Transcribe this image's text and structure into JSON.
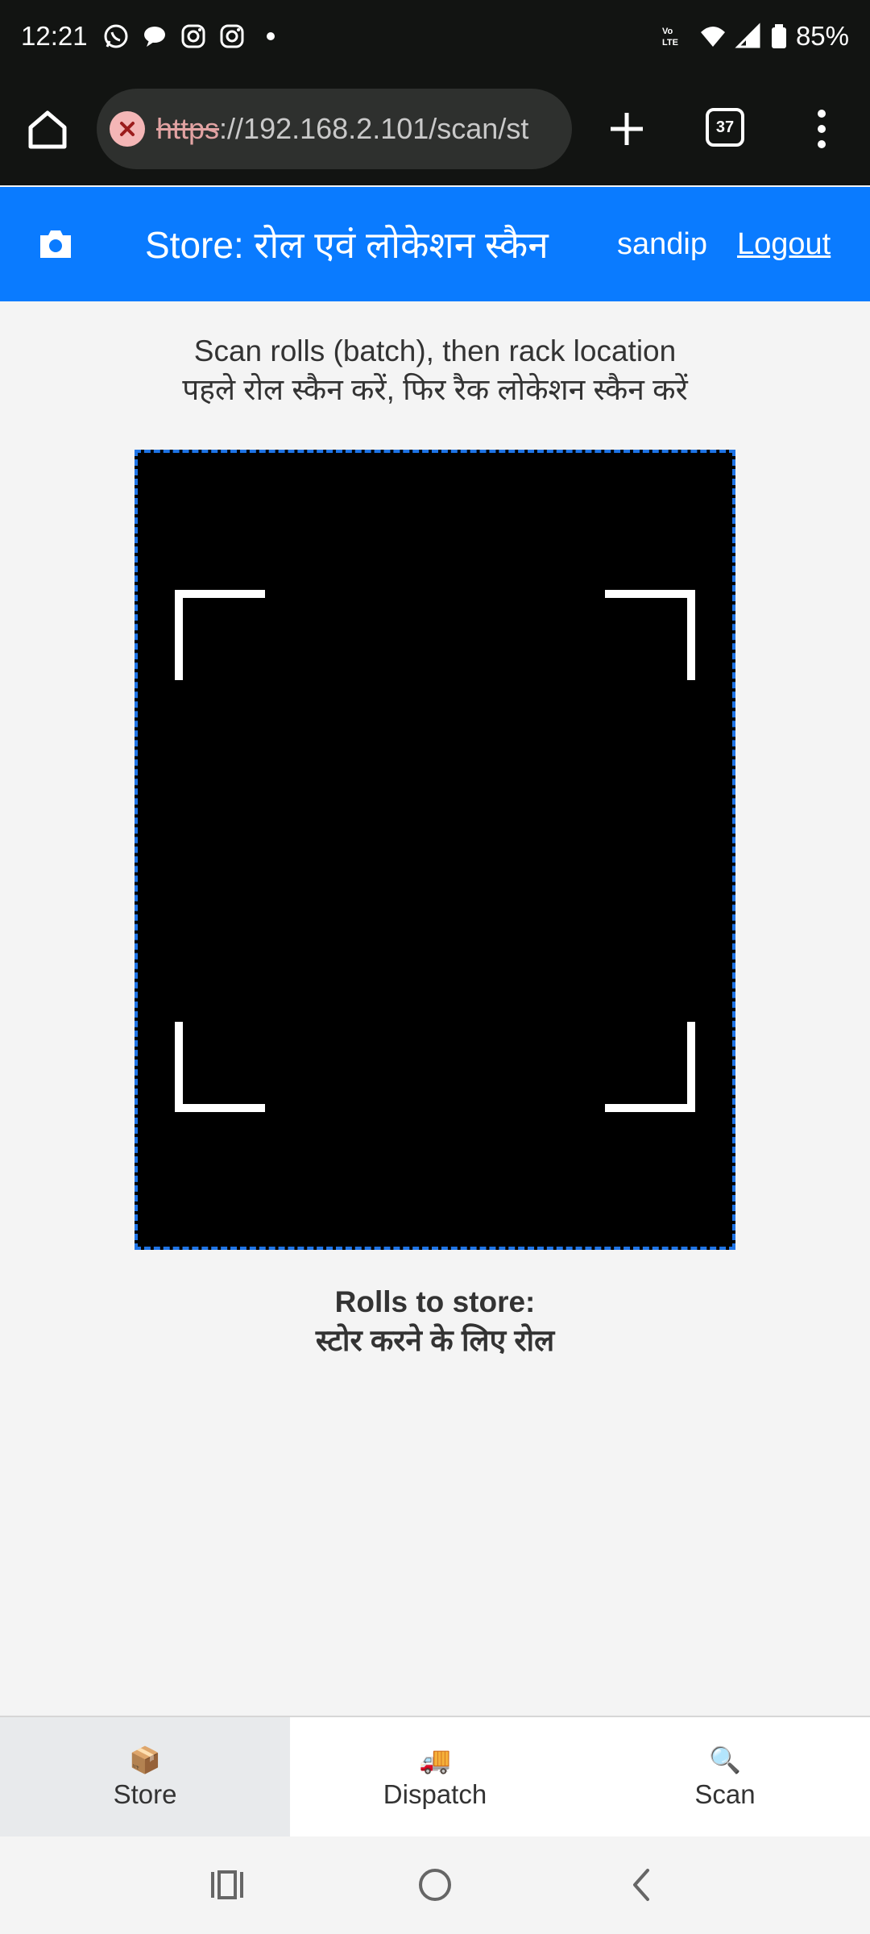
{
  "status_bar": {
    "time": "12:21",
    "battery": "85%",
    "left_icons": [
      "whatsapp-icon",
      "chat-bubble-icon",
      "instagram-icon",
      "instagram-icon",
      "dot-icon"
    ],
    "right_icons": [
      "volte-icon",
      "wifi-icon",
      "signal-icon",
      "battery-icon"
    ]
  },
  "browser": {
    "url_scheme": "https",
    "url_rest": "://192.168.2.101/scan/st",
    "tab_count": "37",
    "colors": {
      "toolbar_bg": "#121412",
      "url_box_bg": "#2e302e",
      "insecure": "#f4b6b6"
    }
  },
  "header": {
    "title": "Store: रोल एवं लोकेशन स्कैन",
    "user": "sandip",
    "logout": "Logout",
    "color": "#0a7bff"
  },
  "instructions": {
    "line_en": "Scan rolls (batch), then rack location",
    "line_hi": "पहले रोल स्कैन करें, फिर रैक लोकेशन स्कैन करें"
  },
  "scanner": {
    "border_color": "#1f74e6"
  },
  "rolls": {
    "title_en": "Rolls to store:",
    "title_hi": "स्टोर करने के लिए रोल"
  },
  "bottom_nav": {
    "items": [
      {
        "icon": "📦",
        "label": "Store",
        "active": true
      },
      {
        "icon": "🚚",
        "label": "Dispatch",
        "active": false
      },
      {
        "icon": "🔍",
        "label": "Scan",
        "active": false
      }
    ]
  },
  "system_nav": {
    "buttons": [
      "recents-icon",
      "home-circle-icon",
      "back-icon"
    ]
  }
}
